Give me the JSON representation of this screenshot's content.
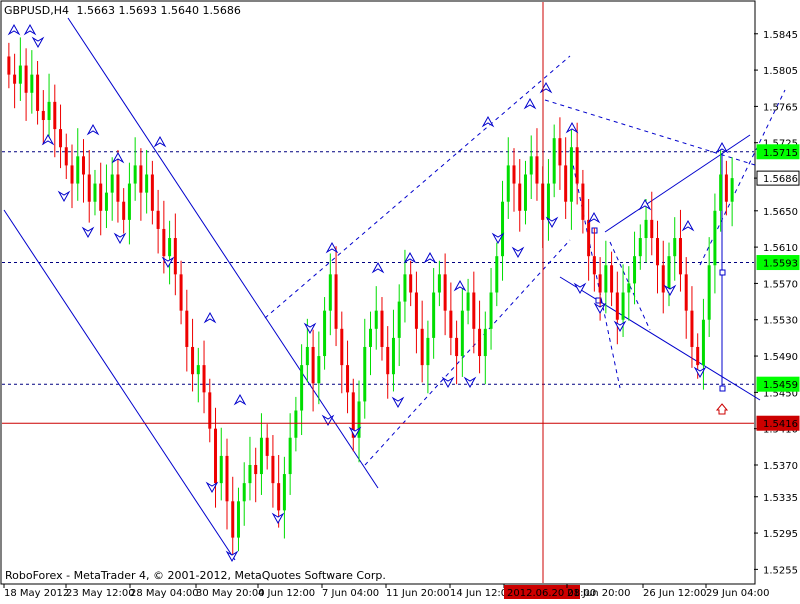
{
  "header": {
    "symbol_timeframe": "GBPUSD,H4",
    "ohlc": "1.5663 1.5693 1.5640 1.5686"
  },
  "footer": {
    "copyright": "RoboForex - MetaTrader 4, © 2001-2012, MetaQuotes Software Corp."
  },
  "colors": {
    "background": "#ffffff",
    "bull_candle": "#00dd00",
    "bear_candle": "#ee0000",
    "trendline": "#0000cc",
    "level_line": "#000080",
    "vertical_marker": "#cc0000",
    "horizontal_marker": "#cc0000",
    "current_price_box": "#ffffff",
    "highlight_box": "#00ff00"
  },
  "chart_data": {
    "type": "candlestick",
    "symbol": "GBPUSD",
    "timeframe": "H4",
    "y_ticks": [
      "1.5845",
      "1.5805",
      "1.5765",
      "1.5725",
      "1.5686",
      "1.5650",
      "1.5610",
      "1.5570",
      "1.5530",
      "1.5490",
      "1.5450",
      "1.5410",
      "1.5370",
      "1.5335",
      "1.5295",
      "1.5255"
    ],
    "ylim": [
      1.524,
      1.588
    ],
    "x_ticks": [
      "18 May 2012",
      "23 May 12:00",
      "28 May 04:00",
      "30 May 20:00",
      "4 Jun 12:00",
      "7 Jun 04:00",
      "11 Jun 20:00",
      "14 Jun 12:00",
      "2012.06.20 08:00",
      "21 Jun 20:00",
      "26 Jun 12:00",
      "29 Jun 04:00"
    ],
    "highlighted_x_tick": "2012.06.20 08:00",
    "price_labels": [
      {
        "value": "1.5715",
        "style": "highlight"
      },
      {
        "value": "1.5686",
        "style": "current"
      },
      {
        "value": "1.5593",
        "style": "highlight"
      },
      {
        "value": "1.5459",
        "style": "highlight"
      },
      {
        "value": "1.5416",
        "style": "red"
      }
    ],
    "horizontal_levels": [
      1.5715,
      1.5593,
      1.5459
    ],
    "horizontal_marker_level": 1.5416,
    "vertical_marker_x_tick": "2012.06.20 08:00",
    "closes": [
      1.58,
      1.579,
      1.581,
      1.578,
      1.58,
      1.576,
      1.575,
      1.577,
      1.574,
      1.572,
      1.57,
      1.568,
      1.571,
      1.569,
      1.566,
      1.568,
      1.565,
      1.567,
      1.569,
      1.566,
      1.564,
      1.568,
      1.57,
      1.567,
      1.569,
      1.565,
      1.563,
      1.56,
      1.562,
      1.558,
      1.554,
      1.55,
      1.547,
      1.548,
      1.545,
      1.541,
      1.535,
      1.538,
      1.533,
      1.529,
      1.533,
      1.535,
      1.537,
      1.536,
      1.54,
      1.538,
      1.535,
      1.532,
      1.536,
      1.54,
      1.543,
      1.548,
      1.55,
      1.546,
      1.549,
      1.554,
      1.558,
      1.552,
      1.548,
      1.545,
      1.54,
      1.544,
      1.55,
      1.552,
      1.554,
      1.55,
      1.547,
      1.551,
      1.555,
      1.558,
      1.556,
      1.552,
      1.548,
      1.551,
      1.556,
      1.558,
      1.554,
      1.551,
      1.549,
      1.554,
      1.556,
      1.552,
      1.549,
      1.552,
      1.556,
      1.56,
      1.566,
      1.57,
      1.568,
      1.565,
      1.569,
      1.571,
      1.568,
      1.564,
      1.568,
      1.573,
      1.57,
      1.566,
      1.572,
      1.568,
      1.564,
      1.56,
      1.558,
      1.556,
      1.559,
      1.556,
      1.553,
      1.556,
      1.557,
      1.56,
      1.562,
      1.564,
      1.562,
      1.559,
      1.556,
      1.56,
      1.562,
      1.558,
      1.554,
      1.55,
      1.548,
      1.553,
      1.559,
      1.565,
      1.569,
      1.566,
      1.5686
    ]
  }
}
